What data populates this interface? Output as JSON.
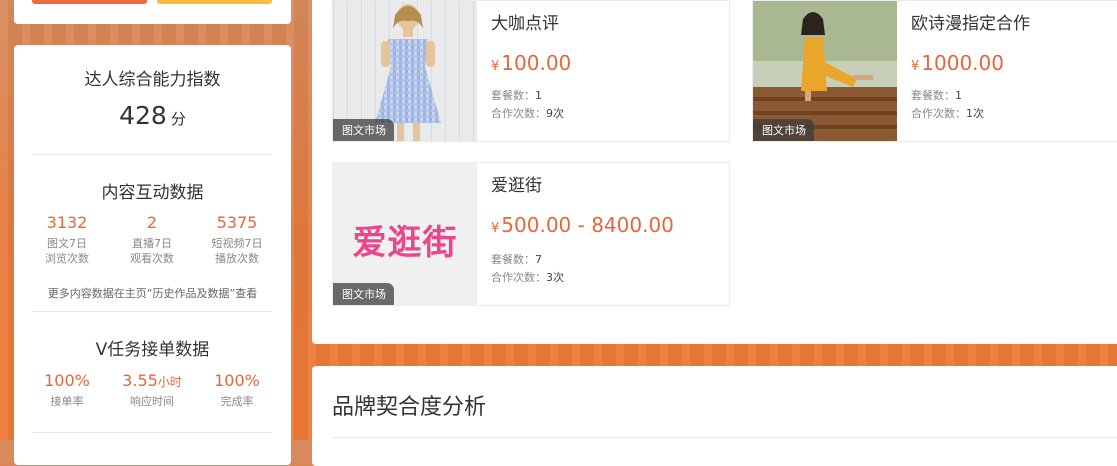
{
  "sidebar": {
    "ability": {
      "title": "达人综合能力指数",
      "score": "428",
      "unit": "分"
    },
    "content": {
      "title": "内容互动数据",
      "stats": [
        {
          "value": "3132",
          "label1": "图文7日",
          "label2": "浏览次数"
        },
        {
          "value": "2",
          "label1": "直播7日",
          "label2": "观看次数"
        },
        {
          "value": "5375",
          "label1": "短视频7日",
          "label2": "播放次数"
        }
      ],
      "note": "更多内容数据在主页“历史作品及数据”查看"
    },
    "vtask": {
      "title": "V任务接单数据",
      "stats": [
        {
          "value": "100%",
          "suffix": "",
          "label": "接单率"
        },
        {
          "value": "3.55",
          "suffix": "小时",
          "label": "响应时间"
        },
        {
          "value": "100%",
          "suffix": "",
          "label": "完成率"
        }
      ]
    }
  },
  "items": [
    {
      "title": "大咖点评",
      "currency": "¥",
      "price": "100.00",
      "packages_label": "套餐数：",
      "packages": "1",
      "coop_label": "合作次数：",
      "coop": "9次",
      "tag": "图文市场"
    },
    {
      "title": "欧诗漫指定合作",
      "currency": "¥",
      "price": "1000.00",
      "packages_label": "套餐数：",
      "packages": "1",
      "coop_label": "合作次数：",
      "coop": "1次",
      "tag": "图文市场"
    },
    {
      "title": "爱逛街",
      "currency": "¥",
      "price": "500.00 - 8400.00",
      "packages_label": "套餐数：",
      "packages": "7",
      "coop_label": "合作次数：",
      "coop": "3次",
      "tag": "图文市场",
      "logo_text": "爱逛街"
    }
  ],
  "brand": {
    "title": "品牌契合度分析"
  },
  "colors": {
    "accent": "#e8663c",
    "button_primary": "#f06a3c",
    "button_secondary": "#f8bd3b"
  }
}
